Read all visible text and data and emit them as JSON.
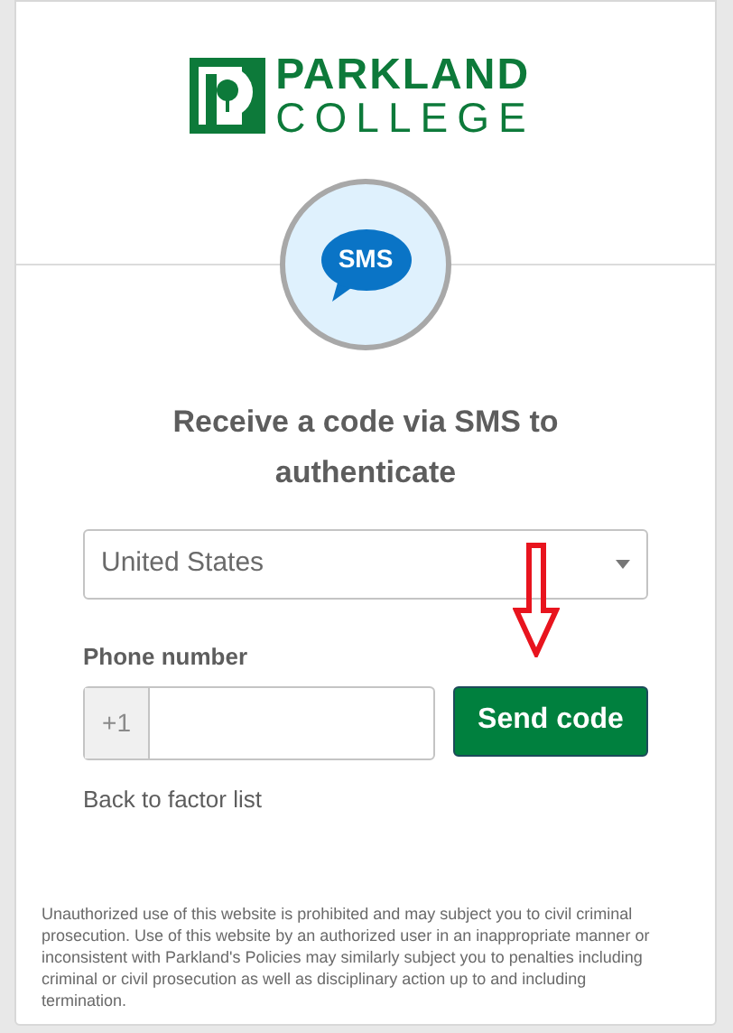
{
  "logo": {
    "line_1": "PARKLAND",
    "line_2": "COLLEGE"
  },
  "factor_badge": "SMS",
  "heading": "Receive a code via SMS to authenticate",
  "country_select": {
    "value": "United States"
  },
  "phone": {
    "label": "Phone number",
    "prefix": "+1"
  },
  "send_button": "Send code",
  "back_link": "Back to factor list",
  "footer": "Unauthorized use of this website is prohibited and may subject you to civil criminal prosecution. Use of this website by an authorized user in an inappropriate manner or inconsistent with Parkland's Policies may similarly subject you to penalties including criminal or civil prosecution as well as disciplinary action up to and including termination."
}
